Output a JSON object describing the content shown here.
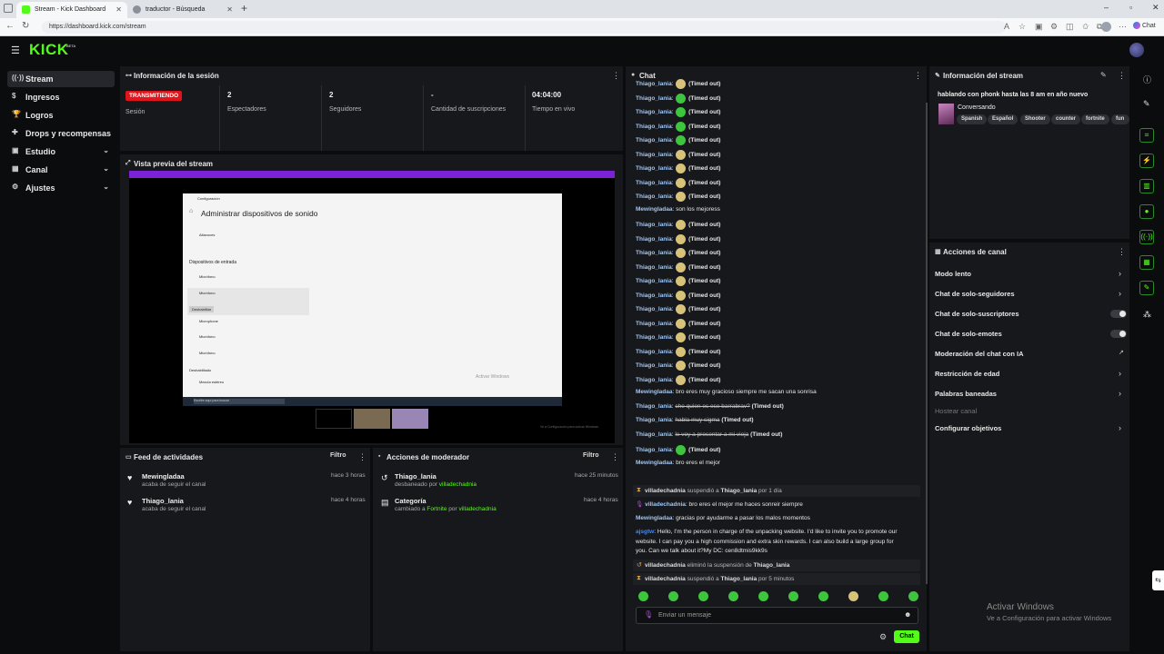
{
  "browser": {
    "tabs": [
      {
        "title": "Stream - Kick Dashboard",
        "active": true
      },
      {
        "title": "traductor - Búsqueda",
        "active": false
      }
    ],
    "url": "https://dashboard.kick.com/stream",
    "chat_label": "Chat"
  },
  "brand": {
    "logo": "KICK",
    "beta": "BETA",
    "accent": "#53fc18"
  },
  "sidebar": {
    "items": [
      {
        "label": "Stream",
        "icon": "broadcast-icon"
      },
      {
        "label": "Ingresos",
        "icon": "coins-icon"
      },
      {
        "label": "Logros",
        "icon": "trophy-icon"
      },
      {
        "label": "Drops y recompensas",
        "icon": "gift-icon"
      },
      {
        "label": "Estudio",
        "icon": "camera-icon"
      },
      {
        "label": "Canal",
        "icon": "channel-icon"
      },
      {
        "label": "Ajustes",
        "icon": "gear-icon"
      }
    ]
  },
  "session": {
    "title": "Información de la sesión",
    "live_badge": "TRANSMITIENDO",
    "session_label": "Sesión",
    "stats": [
      {
        "value": "2",
        "label": "Espectadores"
      },
      {
        "value": "2",
        "label": "Seguidores"
      },
      {
        "value": "-",
        "label": "Cantidad de suscripciones"
      },
      {
        "value": "04:04:00",
        "label": "Tiempo en vivo"
      }
    ]
  },
  "preview": {
    "title": "Vista previa del stream",
    "window_title": "Configuración",
    "heading": "Administrar dispositivos de sonido",
    "input_section": "Dispositivos de entrada",
    "devices": [
      "Altavoces",
      "Micrófono",
      "Micrófono",
      "Microphone",
      "Micrófono",
      "Micrófono",
      "Mezcla estéreo"
    ],
    "button": "Deshabilitar",
    "disabled_section": "Deshabilitado",
    "activate_title": "Activar Windows",
    "activate_sub": "Ve a Configuración para activar Windows",
    "search_placeholder": "Escribe aquí para buscar"
  },
  "activity": {
    "title": "Feed de actividades",
    "filter": "Filtro",
    "items": [
      {
        "user": "Mewingladaa",
        "action": "acaba de seguir el canal",
        "time": "hace 3 horas"
      },
      {
        "user": "Thiago_lania",
        "action": "acaba de seguir el canal",
        "time": "hace 4 horas"
      }
    ]
  },
  "modactions": {
    "title": "Acciones de moderador",
    "filter": "Filtro",
    "items": [
      {
        "title": "Thiago_lania",
        "pre": "desbaneado por ",
        "target": "",
        "by": "villadechadnia",
        "time": "hace 25 minutos"
      },
      {
        "title": "Categoría",
        "pre": "cambiado a ",
        "target": "Fortnite",
        "mid": " por ",
        "by": "villadechadnia",
        "time": "hace 4 horas"
      }
    ]
  },
  "chat": {
    "title": "Chat",
    "timeout_text": "(Timed out)",
    "messages": [
      {
        "user": "Thiago_lania",
        "emote": "t",
        "text": "(Timed out)"
      },
      {
        "user": "Thiago_lania",
        "emote": "g",
        "text": "(Timed out)"
      },
      {
        "user": "Thiago_lania",
        "emote": "g",
        "text": "(Timed out)"
      },
      {
        "user": "Thiago_lania",
        "emote": "g",
        "text": "(Timed out)"
      },
      {
        "user": "Thiago_lania",
        "emote": "g",
        "text": "(Timed out)"
      },
      {
        "user": "Thiago_lania",
        "emote": "t",
        "text": "(Timed out)"
      },
      {
        "user": "Thiago_lania",
        "emote": "t",
        "text": "(Timed out)"
      },
      {
        "user": "Thiago_lania",
        "emote": "t",
        "text": "(Timed out)"
      },
      {
        "user": "Thiago_lania",
        "emote": "t",
        "text": "(Timed out)"
      },
      {
        "user": "Mewingladaa",
        "emote": "",
        "text": "son los mejoress"
      },
      {
        "user": "Thiago_lania",
        "emote": "t",
        "text": "(Timed out)"
      },
      {
        "user": "Thiago_lania",
        "emote": "t",
        "text": "(Timed out)"
      },
      {
        "user": "Thiago_lania",
        "emote": "t",
        "text": "(Timed out)"
      },
      {
        "user": "Thiago_lania",
        "emote": "t",
        "text": "(Timed out)"
      },
      {
        "user": "Thiago_lania",
        "emote": "t",
        "text": "(Timed out)"
      },
      {
        "user": "Thiago_lania",
        "emote": "t",
        "text": "(Timed out)"
      },
      {
        "user": "Thiago_lania",
        "emote": "t",
        "text": "(Timed out)"
      },
      {
        "user": "Thiago_lania",
        "emote": "t",
        "text": "(Timed out)"
      },
      {
        "user": "Thiago_lania",
        "emote": "t",
        "text": "(Timed out)"
      },
      {
        "user": "Thiago_lania",
        "emote": "t",
        "text": "(Timed out)"
      },
      {
        "user": "Thiago_lania",
        "emote": "t",
        "text": "(Timed out)"
      },
      {
        "user": "Thiago_lania",
        "emote": "t",
        "text": "(Timed out)"
      },
      {
        "user": "Mewingladaa",
        "emote": "",
        "text": "bro eres muy gracioso siempre me sacan una sonrisa"
      },
      {
        "user": "Thiago_lania",
        "emote": "",
        "strike": "che quien es ese barrabrav?",
        "text": "(Timed out)"
      },
      {
        "user": "Thiago_lania",
        "emote": "",
        "strike": "habla muy sigma",
        "text": "(Timed out)"
      },
      {
        "user": "Thiago_lania",
        "emote": "",
        "strike": "le voy a presentar a mi vieja",
        "text": "(Timed out)"
      },
      {
        "user": "Thiago_lania",
        "emote": "g",
        "text": "(Timed out)"
      },
      {
        "user": "Mewingladaa",
        "emote": "",
        "text": "bro eres el mejor"
      }
    ],
    "system1": {
      "by": "villadechadnia",
      "verb": "suspendió a",
      "target": "Thiago_lania",
      "tail": "por 1 día"
    },
    "vip_msg": {
      "user": "villadechadnia",
      "text": "bro eres el mejor me haces sonreir siempre"
    },
    "mew_msg": {
      "user": "Mewingladaa",
      "text": "gracias por ayudarme a pasar los malos momentos"
    },
    "spam_msg": {
      "user": "ajsgtw",
      "line1": "Hello, I'm the person in charge of the unpacking website. I'd like to invite you to promote our",
      "line2": "website. I can pay you a high commission and extra skin rewards. I can also build a large group for",
      "line3": "you. Can we talk about it?My DC: cen8dtmis9kk9s"
    },
    "system2": {
      "by": "villadechadnia",
      "verb": "eliminó la suspensión de",
      "target": "Thiago_lania"
    },
    "system3": {
      "by": "villadechadnia",
      "verb": "suspendió a",
      "target": "Thiago_lania",
      "tail": "por 5 minutos"
    },
    "input_placeholder": "Enviar un mensaje",
    "send_button": "Chat"
  },
  "stream_info": {
    "title": "Información del stream",
    "stream_title": "hablando con phonk hasta las 8 am en año nuevo",
    "category": "Conversando",
    "tags": [
      "Spanish",
      "Español",
      "Shooter",
      "counter",
      "fortnite",
      "fun"
    ]
  },
  "channel_actions": {
    "title": "Acciones de canal",
    "items": [
      {
        "label": "Modo lento",
        "control": "chevron"
      },
      {
        "label": "Chat de solo-seguidores",
        "control": "chevron"
      },
      {
        "label": "Chat de solo-suscriptores",
        "control": "toggle"
      },
      {
        "label": "Chat de solo-emotes",
        "control": "toggle"
      },
      {
        "label": "Moderación del chat con IA",
        "control": "external"
      },
      {
        "label": "Restricción de edad",
        "control": "chevron"
      },
      {
        "label": "Palabras baneadas",
        "control": "chevron"
      },
      {
        "label": "Hostear canal",
        "control": "disabled"
      },
      {
        "label": "Configurar objetivos",
        "control": "chevron"
      }
    ]
  },
  "watermark": {
    "title": "Activar Windows",
    "sub": "Ve a Configuración para activar Windows"
  }
}
